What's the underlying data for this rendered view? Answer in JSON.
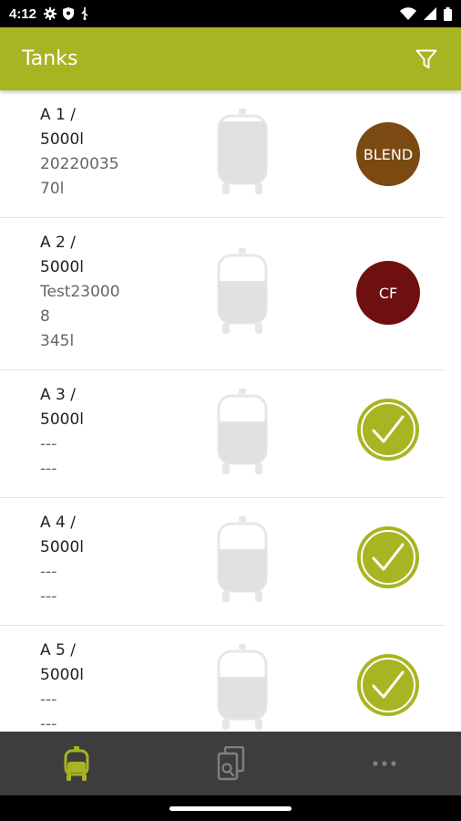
{
  "status_bar": {
    "time": "4:12",
    "left_icons": [
      "gear-icon",
      "shield-icon",
      "usb-icon"
    ],
    "right_icons": [
      "wifi-icon",
      "signal-icon",
      "battery-icon"
    ]
  },
  "app_bar": {
    "title": "Tanks",
    "filter_icon": "filter-icon"
  },
  "colors": {
    "accent": "#a8b522",
    "blend_badge": "#7a4a12",
    "cf_badge": "#6e1010",
    "tank_fill": "#e1e1e1",
    "nav_background": "#3d3d3d"
  },
  "tanks": [
    {
      "name": "A 1 /\n5000l",
      "code": "20220035",
      "volume": "70l",
      "fill": 0.92,
      "status": "badge",
      "badge_label": "BLEND"
    },
    {
      "name": "A 2 /\n5000l",
      "code": "Test23000\n8",
      "volume": "345l",
      "fill": 0.62,
      "status": "badge",
      "badge_label": "CF"
    },
    {
      "name": "A 3 /\n5000l",
      "code": "---",
      "volume": "---",
      "fill": 0.62,
      "status": "check",
      "badge_label": ""
    },
    {
      "name": "A 4 /\n5000l",
      "code": "---",
      "volume": "---",
      "fill": 0.62,
      "status": "check",
      "badge_label": ""
    },
    {
      "name": "A 5 /\n5000l",
      "code": "---",
      "volume": "---",
      "fill": 0.62,
      "status": "check",
      "badge_label": ""
    }
  ],
  "bottom_nav": {
    "items": [
      {
        "icon": "tank-icon",
        "active": true
      },
      {
        "icon": "search-document-icon",
        "active": false
      },
      {
        "icon": "more-icon",
        "active": false
      }
    ]
  }
}
